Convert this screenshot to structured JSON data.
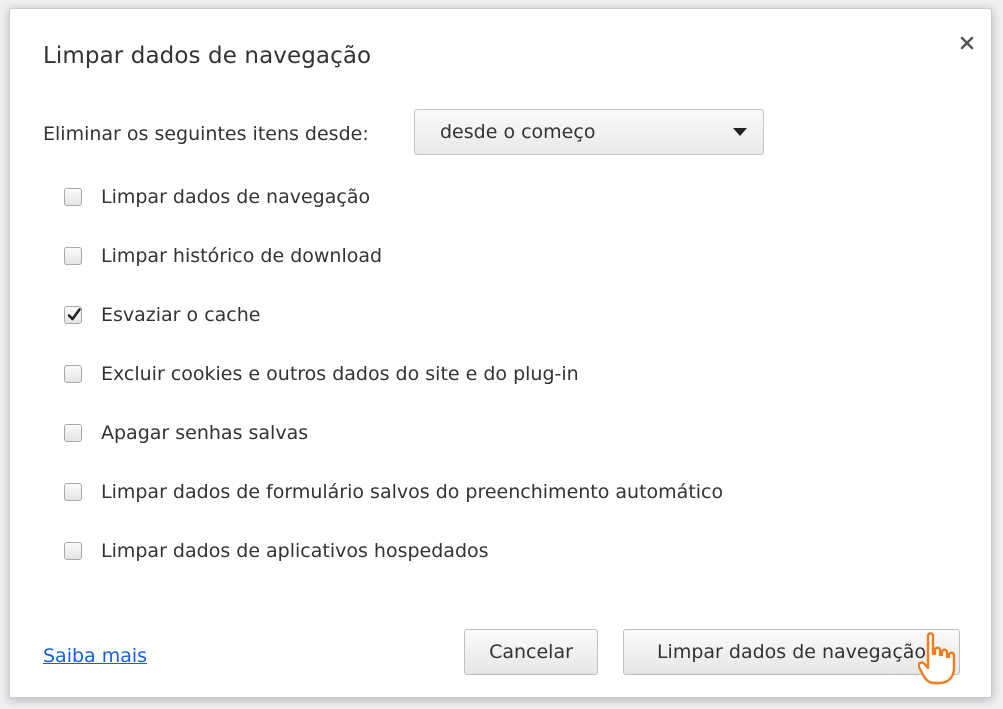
{
  "dialog": {
    "title": "Limpar dados de navegação",
    "close_icon": "close-icon"
  },
  "range": {
    "label": "Eliminar os seguintes itens desde:",
    "selected": "desde o começo"
  },
  "options": [
    {
      "label": "Limpar dados de navegação",
      "checked": false
    },
    {
      "label": "Limpar histórico de download",
      "checked": false
    },
    {
      "label": "Esvaziar o cache",
      "checked": true
    },
    {
      "label": "Excluir cookies e outros dados do site e do plug-in",
      "checked": false
    },
    {
      "label": "Apagar senhas salvas",
      "checked": false
    },
    {
      "label": "Limpar dados de formulário salvos do preenchimento automático",
      "checked": false
    },
    {
      "label": "Limpar dados de aplicativos hospedados",
      "checked": false
    }
  ],
  "footer": {
    "learn_more": "Saiba mais",
    "cancel": "Cancelar",
    "clear": "Limpar dados de navegação"
  },
  "colors": {
    "link": "#1a5fd6",
    "cursor": "#f07c1e"
  }
}
